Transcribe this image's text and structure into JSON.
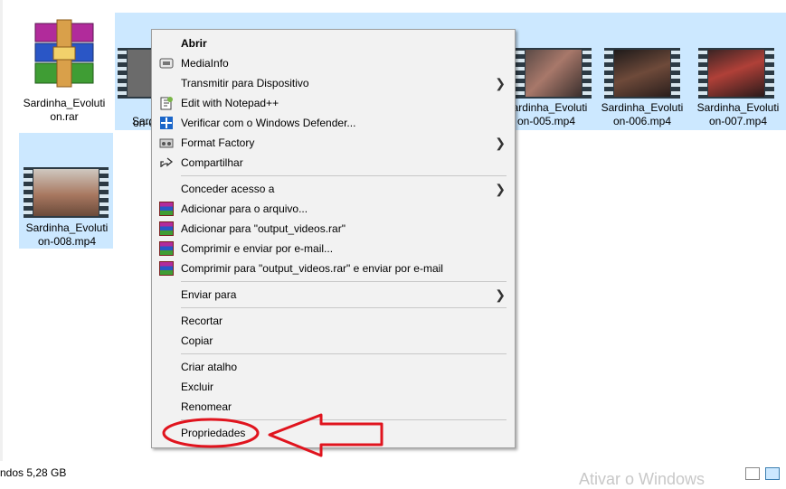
{
  "files": [
    {
      "name": "Sardinha_Evolution.rar",
      "type": "rar",
      "selected": false
    },
    {
      "name": "Sardinha_Evolution-00",
      "type": "video",
      "selected": true
    },
    {
      "name": "",
      "type": "video",
      "selected": true
    },
    {
      "name": "",
      "type": "video",
      "selected": true
    },
    {
      "name": "",
      "type": "video",
      "selected": true
    },
    {
      "name": "Sardinha_Evolution-005.mp4",
      "type": "video",
      "selected": true
    },
    {
      "name": "Sardinha_Evolution-006.mp4",
      "type": "video",
      "selected": true
    },
    {
      "name": "Sardinha_Evolution-007.mp4",
      "type": "video",
      "selected": true
    },
    {
      "name": "Sardinha_Evolution-008.mp4",
      "type": "video",
      "selected": true
    }
  ],
  "file_labels": {
    "f0": [
      "Sardinha_Evoluti",
      "on.rar"
    ],
    "f1": [
      "Sardinha_",
      "on-0"
    ],
    "f5": [
      "Sardinha_Evoluti",
      "on-005.mp4"
    ],
    "f6": [
      "Sardinha_Evoluti",
      "on-006.mp4"
    ],
    "f7": [
      "Sardinha_Evoluti",
      "on-007.mp4"
    ],
    "f8": [
      "Sardinha_Evoluti",
      "on-008.mp4"
    ]
  },
  "context_menu": {
    "open": "Abrir",
    "mediainfo": "MediaInfo",
    "cast": "Transmitir para Dispositivo",
    "notepad": "Edit with Notepad++",
    "defender": "Verificar com o Windows Defender...",
    "format_factory": "Format Factory",
    "share": "Compartilhar",
    "give_access": "Conceder acesso a",
    "add_archive": "Adicionar para o arquivo...",
    "add_rar": "Adicionar para \"output_videos.rar\"",
    "compress_email": "Comprimir e enviar por e-mail...",
    "compress_rar_email": "Comprimir para \"output_videos.rar\" e enviar por e-mail",
    "send_to": "Enviar para",
    "cut": "Recortar",
    "copy": "Copiar",
    "create_shortcut": "Criar atalho",
    "delete": "Excluir",
    "rename": "Renomear",
    "properties": "Propriedades"
  },
  "status": {
    "text": "ndos  5,28 GB"
  },
  "watermark": "Ativar o Windows",
  "colors": {
    "selection": "#cce8ff",
    "annotation": "#e0141e",
    "menu_bg": "#f2f2f2"
  },
  "icons": {
    "submenu": "chevron-right-icon",
    "annotation": "red-arrow-and-ellipse"
  }
}
